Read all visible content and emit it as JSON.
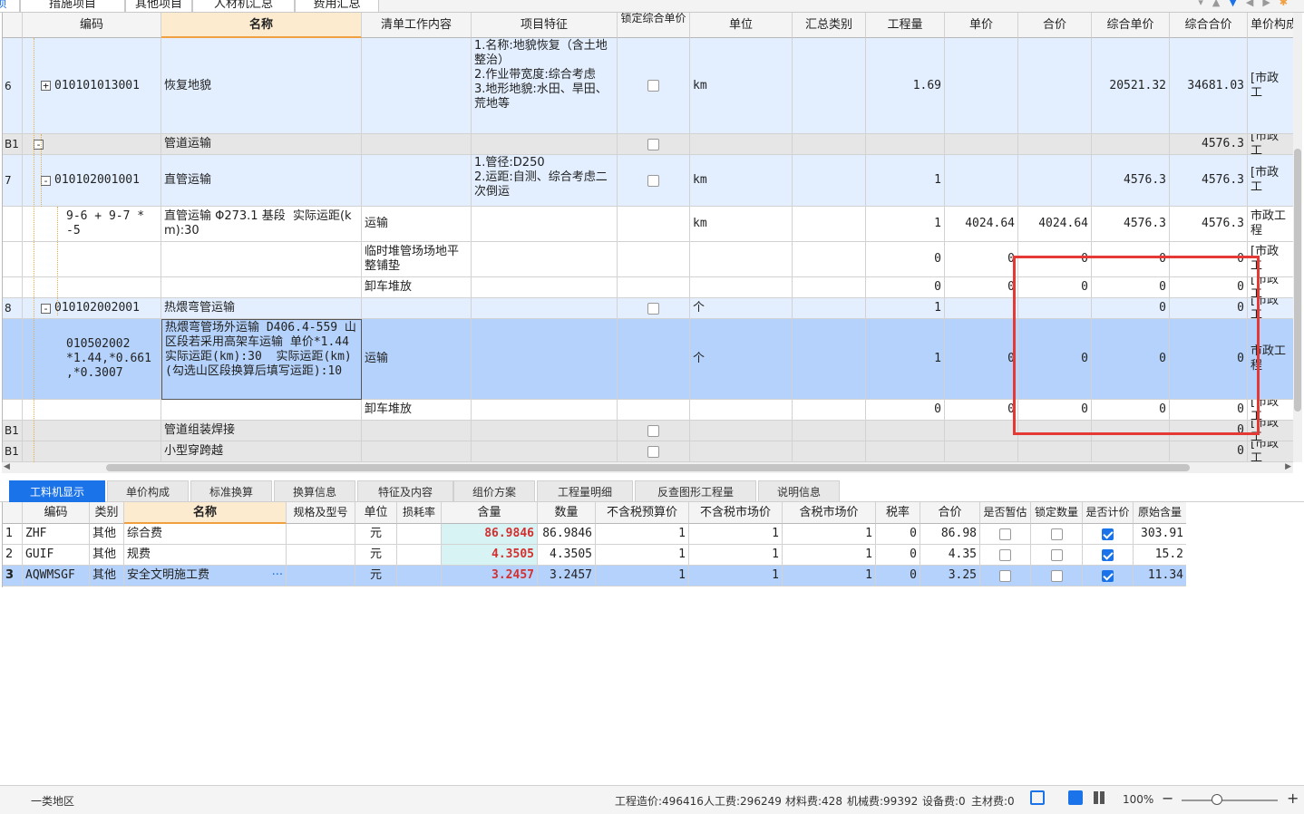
{
  "top_tabs": [
    "项",
    "措施项目",
    "其他项目",
    "人材机汇总",
    "费用汇总"
  ],
  "main_headers": [
    "编码",
    "名称",
    "清单工作内容",
    "项目特征",
    "锁定综合单价",
    "单位",
    "汇总类别",
    "工程量",
    "单价",
    "合价",
    "综合单价",
    "综合合价",
    "单价构成"
  ],
  "rows": [
    {
      "no": "6",
      "expander": "+",
      "code": "010101013001",
      "name": "恢复地貌",
      "work": "",
      "feature": "1.名称:地貌恢复（含土地整治）\n2.作业带宽度:综合考虑\n3.地形地貌:水田、旱田、荒地等",
      "lock": true,
      "unit": "km",
      "cat": "",
      "qty": "1.69",
      "price": "",
      "total": "",
      "cprice": "20521.32",
      "ctotal": "34681.03",
      "build": "[市政工"
    },
    {
      "no": "B1",
      "expander": "-",
      "code": "",
      "name": "管道运输",
      "work": "",
      "feature": "",
      "lock": true,
      "unit": "",
      "cat": "",
      "qty": "",
      "price": "",
      "total": "",
      "cprice": "",
      "ctotal": "4576.3",
      "build": "[市政工"
    },
    {
      "no": "7",
      "expander": "-",
      "code": "010102001001",
      "name": "直管运输",
      "work": "",
      "feature": "1.管径:D250\n2.运距:自测、综合考虑二次倒运",
      "lock": true,
      "unit": "km",
      "cat": "",
      "qty": "1",
      "price": "",
      "total": "",
      "cprice": "4576.3",
      "ctotal": "4576.3",
      "build": "[市政工"
    },
    {
      "no": "",
      "expander": "",
      "code": "9-6 + 9-7 *\n-5",
      "name": "直管运输 Φ273.1 基段  实际运距(km):30",
      "work": "运输",
      "feature": "",
      "lock": false,
      "unit": "km",
      "cat": "",
      "qty": "1",
      "price": "4024.64",
      "total": "4024.64",
      "cprice": "4576.3",
      "ctotal": "4576.3",
      "build": "市政工程"
    },
    {
      "no": "",
      "expander": "",
      "code": "",
      "name": "",
      "work": "临时堆管场场地平整铺垫",
      "feature": "",
      "lock": false,
      "unit": "",
      "cat": "",
      "qty": "0",
      "price": "0",
      "total": "0",
      "cprice": "0",
      "ctotal": "0",
      "build": "[市政工"
    },
    {
      "no": "",
      "expander": "",
      "code": "",
      "name": "",
      "work": "卸车堆放",
      "feature": "",
      "lock": false,
      "unit": "",
      "cat": "",
      "qty": "0",
      "price": "0",
      "total": "0",
      "cprice": "0",
      "ctotal": "0",
      "build": "[市政工"
    },
    {
      "no": "8",
      "expander": "-",
      "code": "010102002001",
      "name": "热煨弯管运输",
      "work": "",
      "feature": "",
      "lock": true,
      "unit": "个",
      "cat": "",
      "qty": "1",
      "price": "",
      "total": "",
      "cprice": "0",
      "ctotal": "0",
      "build": "[市政工"
    },
    {
      "no": "",
      "expander": "",
      "code": "010502002\n*1.44,*0.661\n,*0.3007",
      "name": "热煨弯管场外运输 D406.4-559 山区段若采用高架车运输 单价*1.44  实际运距(km):30  实际运距(km)(勾选山区段换算后填写运距):10",
      "work": "运输",
      "feature": "",
      "lock": false,
      "unit": "个",
      "cat": "",
      "qty": "1",
      "price": "0",
      "total": "0",
      "cprice": "0",
      "ctotal": "0",
      "build": "市政工程"
    },
    {
      "no": "",
      "expander": "",
      "code": "",
      "name": "",
      "work": "卸车堆放",
      "feature": "",
      "lock": false,
      "unit": "",
      "cat": "",
      "qty": "0",
      "price": "0",
      "total": "0",
      "cprice": "0",
      "ctotal": "0",
      "build": "[市政工"
    },
    {
      "no": "B1",
      "expander": "",
      "code": "",
      "name": "管道组装焊接",
      "work": "",
      "feature": "",
      "lock": true,
      "unit": "",
      "cat": "",
      "qty": "",
      "price": "",
      "total": "",
      "cprice": "",
      "ctotal": "0",
      "build": "[市政工"
    },
    {
      "no": "B1",
      "expander": "",
      "code": "",
      "name": "小型穿跨越",
      "work": "",
      "feature": "",
      "lock": true,
      "unit": "",
      "cat": "",
      "qty": "",
      "price": "",
      "total": "",
      "cprice": "",
      "ctotal": "0",
      "build": "[市政工"
    }
  ],
  "bottom_tabs": [
    "工料机显示",
    "单价构成",
    "标准换算",
    "换算信息",
    "特征及内容",
    "组价方案",
    "工程量明细",
    "反查图形工程量",
    "说明信息"
  ],
  "sub_headers": [
    "编码",
    "类别",
    "名称",
    "规格及型号",
    "单位",
    "损耗率",
    "含量",
    "数量",
    "不含税预算价",
    "不含税市场价",
    "含税市场价",
    "税率",
    "合价",
    "是否暂估",
    "锁定数量",
    "是否计价",
    "原始含量"
  ],
  "sub_rows": [
    {
      "no": "1",
      "code": "ZHF",
      "cat": "其他",
      "name": "综合费",
      "spec": "",
      "unit": "元",
      "loss": "",
      "content": "86.9846",
      "amount": "86.9846",
      "p1": "1",
      "p2": "1",
      "p3": "1",
      "tax": "0",
      "total": "86.98",
      "est": false,
      "lockq": false,
      "price_on": true,
      "orig": "303.91"
    },
    {
      "no": "2",
      "code": "GUIF",
      "cat": "其他",
      "name": "规费",
      "spec": "",
      "unit": "元",
      "loss": "",
      "content": "4.3505",
      "amount": "4.3505",
      "p1": "1",
      "p2": "1",
      "p3": "1",
      "tax": "0",
      "total": "4.35",
      "est": false,
      "lockq": false,
      "price_on": true,
      "orig": "15.2"
    },
    {
      "no": "3",
      "code": "AQWMSGF",
      "cat": "其他",
      "name": "安全文明施工费",
      "spec": "",
      "unit": "元",
      "loss": "",
      "content": "3.2457",
      "amount": "3.2457",
      "p1": "1",
      "p2": "1",
      "p3": "1",
      "tax": "0",
      "total": "3.25",
      "est": false,
      "lockq": false,
      "price_on": true,
      "orig": "11.34"
    }
  ],
  "status": {
    "region": "一类地区",
    "cost": "工程造价:496416",
    "labor": "人工费:296249",
    "material": "材料费:428",
    "machine": "机械费:99392",
    "equipment": "设备费:0",
    "main_material": "主材费:0",
    "zoom": "100%"
  },
  "colors": {
    "accent": "#1a73e8",
    "highlight_box": "#e53935",
    "content_red": "#d32f2f"
  }
}
